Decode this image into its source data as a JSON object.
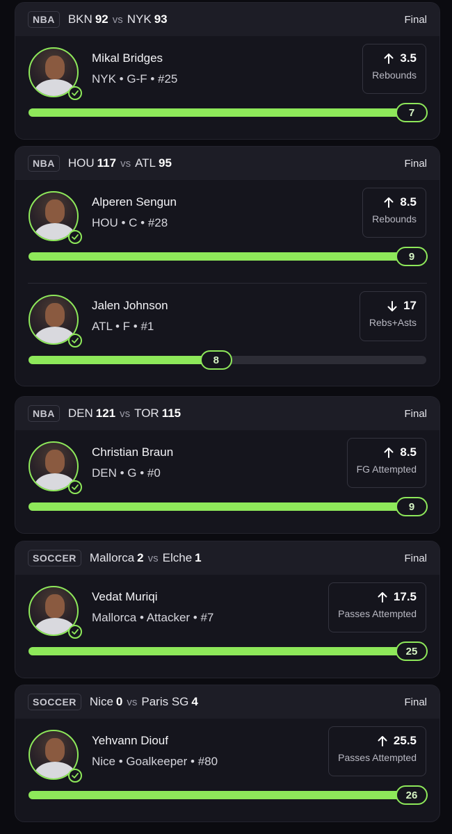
{
  "colors": {
    "accent": "#8ee85a",
    "background": "#0b0b10",
    "card": "#15151d",
    "header": "#1d1d26"
  },
  "cards": [
    {
      "league": "NBA",
      "team1": "BKN",
      "score1": "92",
      "vs": "vs",
      "team2": "NYK",
      "score2": "93",
      "status": "Final",
      "picks": [
        {
          "name": "Mikal Bridges",
          "meta": "NYK • G-F • #25",
          "direction": "up",
          "line": "3.5",
          "stat": "Rebounds",
          "result": "7",
          "progress": 1.0
        }
      ]
    },
    {
      "league": "NBA",
      "team1": "HOU",
      "score1": "117",
      "vs": "vs",
      "team2": "ATL",
      "score2": "95",
      "status": "Final",
      "picks": [
        {
          "name": "Alperen Sengun",
          "meta": "HOU • C • #28",
          "direction": "up",
          "line": "8.5",
          "stat": "Rebounds",
          "result": "9",
          "progress": 1.0
        },
        {
          "name": "Jalen Johnson",
          "meta": "ATL • F • #1",
          "direction": "down",
          "line": "17",
          "stat": "Rebs+Asts",
          "result": "8",
          "progress": 0.47
        }
      ]
    },
    {
      "league": "NBA",
      "team1": "DEN",
      "score1": "121",
      "vs": "vs",
      "team2": "TOR",
      "score2": "115",
      "status": "Final",
      "picks": [
        {
          "name": "Christian Braun",
          "meta": "DEN • G • #0",
          "direction": "up",
          "line": "8.5",
          "stat": "FG Attempted",
          "result": "9",
          "progress": 1.0
        }
      ]
    },
    {
      "league": "SOCCER",
      "team1": "Mallorca",
      "score1": "2",
      "vs": "vs",
      "team2": "Elche",
      "score2": "1",
      "status": "Final",
      "picks": [
        {
          "name": "Vedat Muriqi",
          "meta": "Mallorca • Attacker • #7",
          "direction": "up",
          "line": "17.5",
          "stat": "Passes Attempted",
          "result": "25",
          "progress": 1.0
        }
      ]
    },
    {
      "league": "SOCCER",
      "team1": "Nice",
      "score1": "0",
      "vs": "vs",
      "team2": "Paris SG",
      "score2": "4",
      "status": "Final",
      "picks": [
        {
          "name": "Yehvann Diouf",
          "meta": "Nice • Goalkeeper • #80",
          "direction": "up",
          "line": "25.5",
          "stat": "Passes Attempted",
          "result": "26",
          "progress": 1.0
        }
      ]
    }
  ]
}
